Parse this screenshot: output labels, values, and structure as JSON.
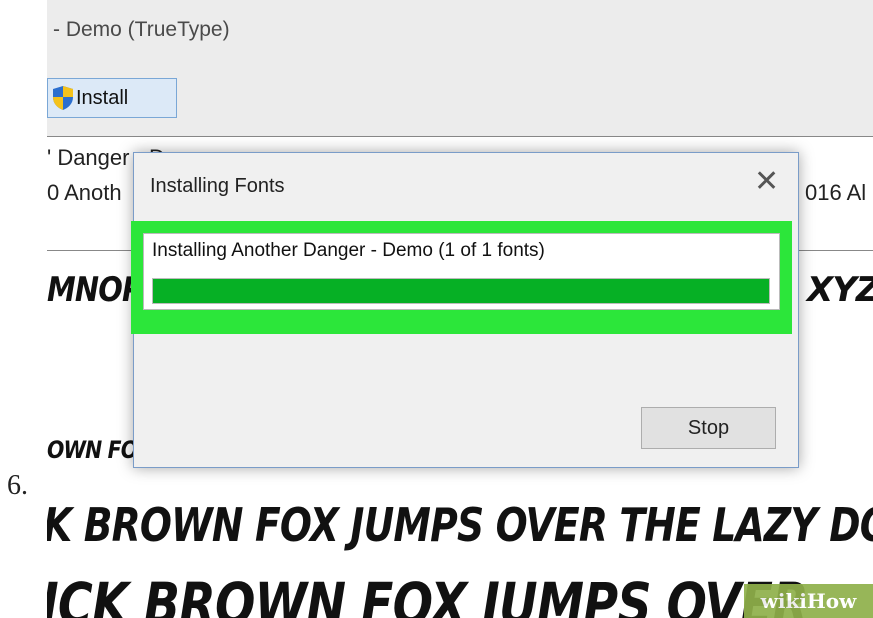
{
  "step_number": "6.",
  "window": {
    "title": "- Demo (TrueType)",
    "toolbar": {
      "install_label": "Install"
    },
    "info": {
      "line1": "' Danger - Demo",
      "line2": "0 Anoth",
      "line2_right": "016 Al"
    },
    "preview": {
      "row1_left": "MNOPQ",
      "row1_right": "XYZ",
      "row2": "OWN FOX JUMPS OVER THE LAZY DOG",
      "row3": "K BROWN FOX JUMPS OVER THE LAZY DOG",
      "row4": "ICK BROWN FOX JUMPS OVER"
    }
  },
  "dialog": {
    "title": "Installing Fonts",
    "status_text": "Installing Another Danger - Demo (1 of 1 fonts)",
    "progress": 1.0,
    "stop_label": "Stop"
  },
  "watermark": "wikiHow",
  "colors": {
    "highlight": "#2ce63a",
    "progress_fill": "#06b025"
  }
}
